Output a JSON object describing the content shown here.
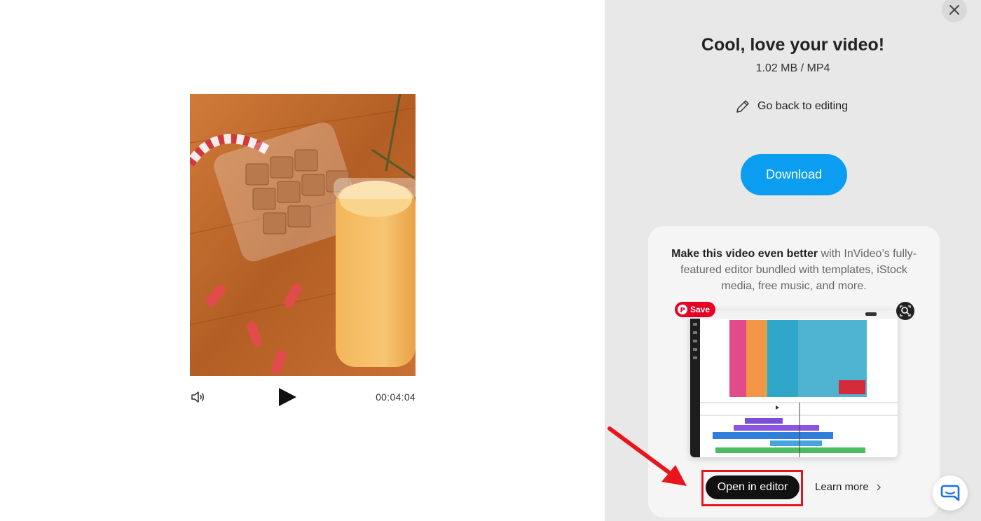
{
  "player": {
    "time": "00:04:04"
  },
  "panel": {
    "title": "Cool, love your video!",
    "file_info": "1.02 MB / MP4",
    "back_label": "Go back to editing",
    "download_label": "Download"
  },
  "promo": {
    "text_bold": "Make this video even better",
    "text_rest": " with InVideo’s fully-featured editor bundled with templates, iStock media, free music, and more.",
    "save_label": "Save",
    "open_label": "Open in editor",
    "learn_label": "Learn more"
  },
  "colors": {
    "accent": "#0a9df0",
    "highlight": "#e8161c",
    "pinterest": "#e60023",
    "chat": "#1a6fe8"
  },
  "icons": {
    "volume": "speaker-icon",
    "play": "play-icon",
    "close": "close-icon",
    "back": "pencil-icon",
    "chat": "chat-bubble-icon"
  }
}
